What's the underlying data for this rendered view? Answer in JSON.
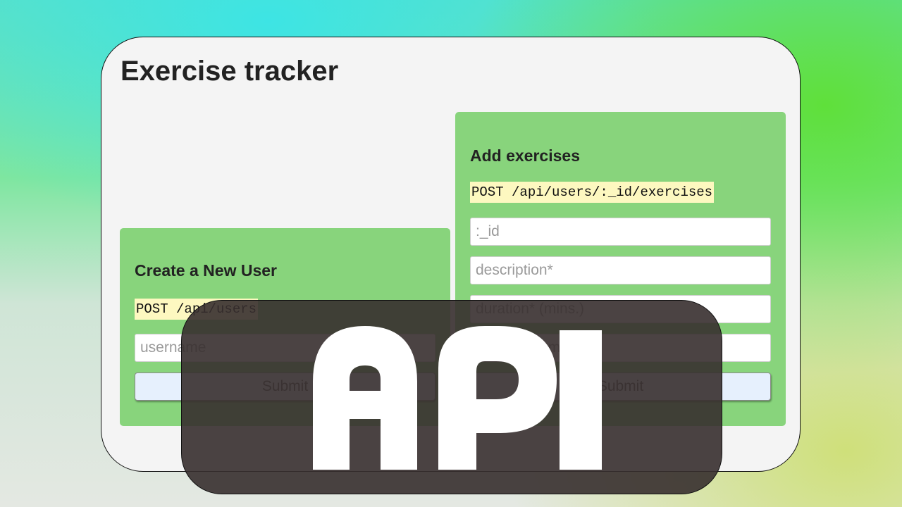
{
  "page": {
    "title": "Exercise tracker"
  },
  "create_user": {
    "heading": "Create a New User",
    "endpoint": "POST /api/users",
    "username_placeholder": "username",
    "submit_label": "Submit"
  },
  "add_exercises": {
    "heading": "Add exercises",
    "endpoint": "POST /api/users/:_id/exercises",
    "id_placeholder": ":_id",
    "description_placeholder": "description*",
    "duration_placeholder": "duration* (mins.)",
    "date_placeholder": "date (yyyy-mm-dd)",
    "submit_label": "Submit"
  },
  "overlay": {
    "logo_text": "API"
  },
  "colors": {
    "card": "#88d47c",
    "endpoint_highlight": "#fdf8c0",
    "submit_bg": "#e6f0fd",
    "overlay_bg": "#372f2f"
  }
}
